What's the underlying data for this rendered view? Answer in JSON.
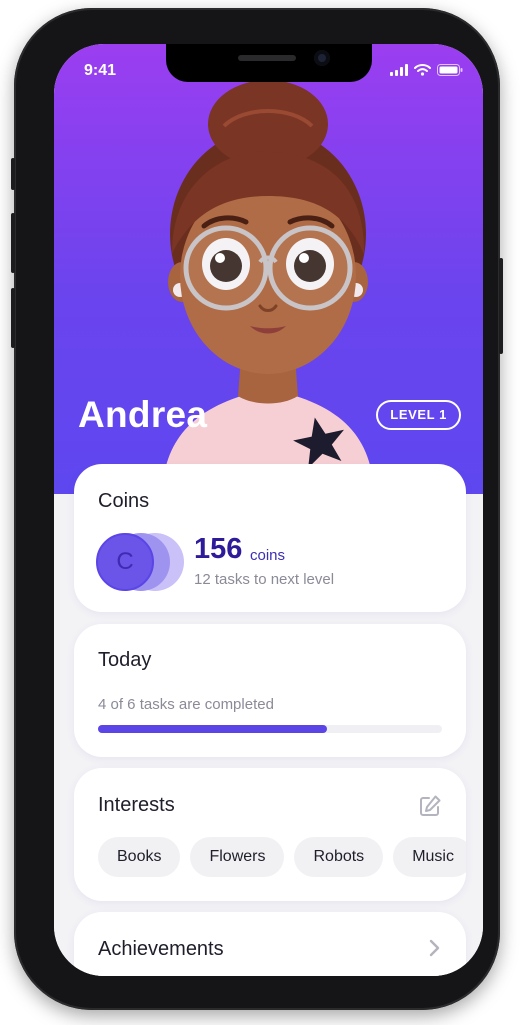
{
  "status_bar": {
    "time": "9:41"
  },
  "profile": {
    "name": "Andrea",
    "level_label": "LEVEL 1"
  },
  "coins": {
    "title": "Coins",
    "coin_letter": "C",
    "amount": "156",
    "unit": "coins",
    "next_level_text": "12 tasks to next level"
  },
  "today": {
    "title": "Today",
    "progress_text": "4 of 6 tasks are completed",
    "progress_fraction": 0.667
  },
  "interests": {
    "title": "Interests",
    "chips": [
      "Books",
      "Flowers",
      "Robots",
      "Music"
    ]
  },
  "achievements": {
    "title": "Achievements"
  },
  "colors": {
    "accent": "#5b45e6",
    "hero_top": "#9b3ef0",
    "hero_bottom": "#5e47ef",
    "coin_dark": "#2d1b99"
  },
  "icons": {
    "edit": "edit-icon",
    "chevron": "chevron-right-icon",
    "signal": "signal-icon",
    "wifi": "wifi-icon",
    "battery": "battery-icon"
  }
}
